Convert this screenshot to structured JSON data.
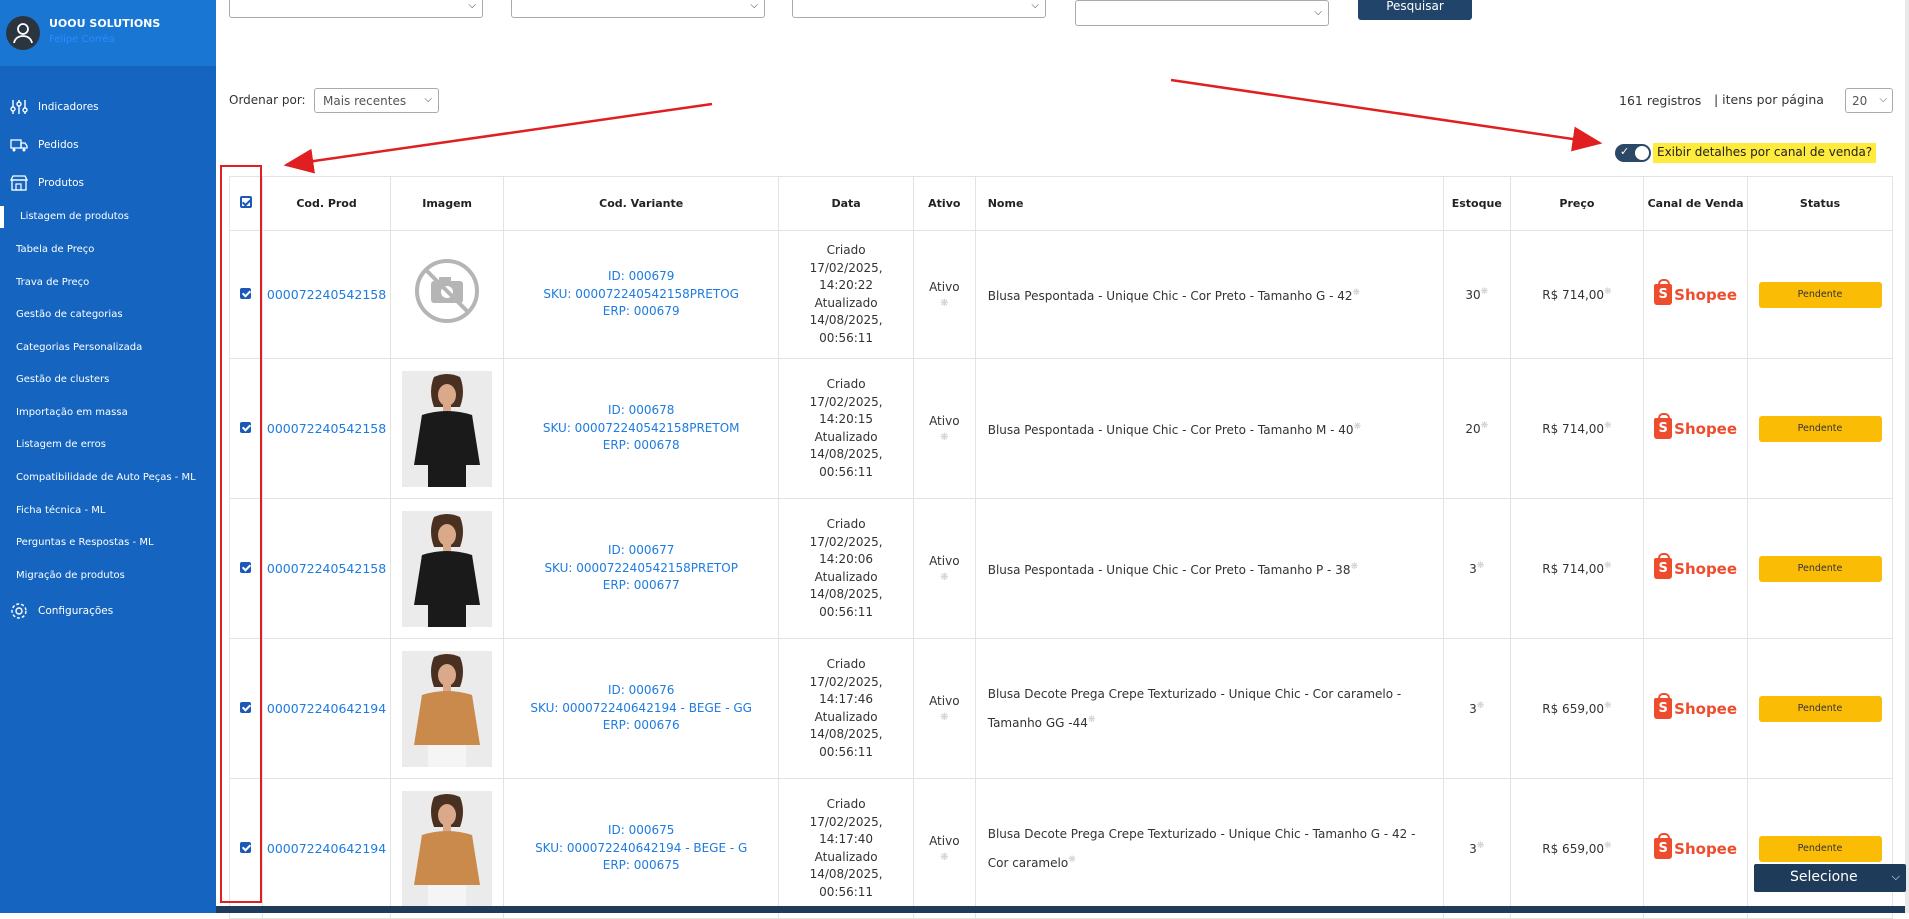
{
  "sidebar": {
    "company": "UOOU SOLUTIONS",
    "user": "Felipe Corrêa",
    "menu": [
      {
        "label": "Indicadores",
        "icon": "sliders-icon"
      },
      {
        "label": "Pedidos",
        "icon": "truck-icon"
      },
      {
        "label": "Produtos",
        "icon": "store-icon"
      }
    ],
    "submenu": [
      "Listagem de produtos",
      "Tabela de Preço",
      "Trava de Preço",
      "Gestão de categorias",
      "Categorias Personalizada",
      "Gestão de clusters",
      "Importação em massa",
      "Listagem de erros",
      "Compatibilidade de Auto Peças - ML",
      "Ficha técnica - ML",
      "Perguntas e Respostas - ML",
      "Migração de produtos"
    ],
    "settings": "Configurações"
  },
  "filters": {
    "search_button": "Pesquisar",
    "order_label": "Ordenar por:",
    "order_value": "Mais recentes",
    "records": "161 registros",
    "per_page_label": "| itens por página",
    "per_page_value": "20",
    "toggle_label": "Exibir detalhes por canal de venda?",
    "toggle_on": true
  },
  "table": {
    "headers": [
      "Cod. Prod",
      "Imagem",
      "Cod. Variante",
      "Data",
      "Ativo",
      "Nome",
      "Estoque",
      "Preço",
      "Canal de Venda",
      "Status"
    ],
    "rows": [
      {
        "cod": "000072240542158",
        "image": "no-image",
        "variant_id": "ID: 000679",
        "sku": "SKU: 000072240542158PRETOG",
        "erp": "ERP: 000679",
        "created_label": "Criado",
        "created_date": "17/02/2025,",
        "created_time": "14:20:22",
        "updated_label": "Atualizado",
        "updated_date": "14/08/2025,",
        "updated_time": "00:56:11",
        "ativo": "Ativo",
        "nome": "Blusa Pespontada - Unique Chic - Cor Preto - Tamanho G - 42",
        "estoque": "30",
        "preco": "R$ 714,00",
        "canal": "Shopee",
        "status": "Pendente"
      },
      {
        "cod": "000072240542158",
        "image": "black-blouse",
        "variant_id": "ID: 000678",
        "sku": "SKU: 000072240542158PRETOM",
        "erp": "ERP: 000678",
        "created_label": "Criado",
        "created_date": "17/02/2025,",
        "created_time": "14:20:15",
        "updated_label": "Atualizado",
        "updated_date": "14/08/2025,",
        "updated_time": "00:56:11",
        "ativo": "Ativo",
        "nome": "Blusa Pespontada - Unique Chic - Cor Preto - Tamanho M - 40",
        "estoque": "20",
        "preco": "R$ 714,00",
        "canal": "Shopee",
        "status": "Pendente"
      },
      {
        "cod": "000072240542158",
        "image": "black-blouse",
        "variant_id": "ID: 000677",
        "sku": "SKU: 000072240542158PRETOP",
        "erp": "ERP: 000677",
        "created_label": "Criado",
        "created_date": "17/02/2025,",
        "created_time": "14:20:06",
        "updated_label": "Atualizado",
        "updated_date": "14/08/2025,",
        "updated_time": "00:56:11",
        "ativo": "Ativo",
        "nome": "Blusa Pespontada - Unique Chic - Cor Preto - Tamanho P - 38",
        "estoque": "3",
        "preco": "R$ 714,00",
        "canal": "Shopee",
        "status": "Pendente"
      },
      {
        "cod": "000072240642194",
        "image": "caramel-blouse",
        "variant_id": "ID: 000676",
        "sku": "SKU: 000072240642194 - BEGE - GG",
        "erp": "ERP: 000676",
        "created_label": "Criado",
        "created_date": "17/02/2025,",
        "created_time": "14:17:46",
        "updated_label": "Atualizado",
        "updated_date": "14/08/2025,",
        "updated_time": "00:56:11",
        "ativo": "Ativo",
        "nome": "Blusa Decote Prega Crepe Texturizado - Unique Chic - Cor caramelo - Tamanho GG -44",
        "estoque": "3",
        "preco": "R$ 659,00",
        "canal": "Shopee",
        "status": "Pendente"
      },
      {
        "cod": "000072240642194",
        "image": "caramel-blouse",
        "variant_id": "ID: 000675",
        "sku": "SKU: 000072240642194 - BEGE - G",
        "erp": "ERP: 000675",
        "created_label": "Criado",
        "created_date": "17/02/2025,",
        "created_time": "14:17:40",
        "updated_label": "Atualizado",
        "updated_date": "14/08/2025,",
        "updated_time": "00:56:11",
        "ativo": "Ativo",
        "nome": "Blusa Decote Prega Crepe Texturizado - Unique Chic - Tamanho G - 42 - Cor caramelo",
        "estoque": "3",
        "preco": "R$ 659,00",
        "canal": "Shopee",
        "status": "Pendente"
      }
    ]
  },
  "floating_select": "Selecione",
  "colors": {
    "sidebar": "#1565c0",
    "link": "#1e7be0",
    "status": "#fbbc05",
    "shopee": "#ee4d2d",
    "annotation": "#e02020",
    "highlight": "#ffeb3b"
  }
}
